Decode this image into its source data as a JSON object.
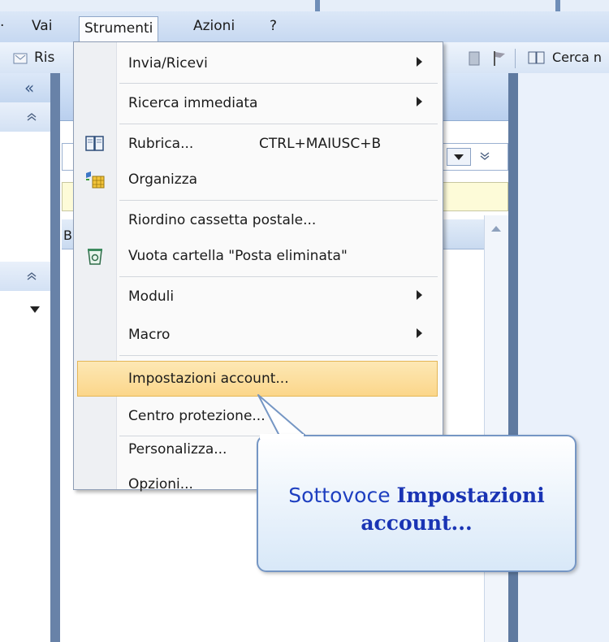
{
  "menubar": {
    "items": [
      {
        "label": "Vai"
      },
      {
        "label": "Strumenti"
      },
      {
        "label": "Azioni"
      },
      {
        "label": "?"
      }
    ]
  },
  "toolbar": {
    "partial_button_label": "Ris",
    "search_label": "Cerca n"
  },
  "navpane": {
    "collapse_symbol": "«",
    "section_toggle_symbol": "⌃"
  },
  "list_pane": {
    "header_letter": "B"
  },
  "dropdown": {
    "items": [
      {
        "label": "Invia/Ricevi",
        "submenu": true
      },
      {
        "label": "Ricerca immediata",
        "submenu": true
      },
      {
        "label": "Rubrica...",
        "shortcut": "CTRL+MAIUSC+B",
        "icon": "address-book-icon"
      },
      {
        "label": "Organizza",
        "icon": "organize-icon"
      },
      {
        "label": "Riordino cassetta postale..."
      },
      {
        "label": "Vuota cartella \"Posta eliminata\"",
        "icon": "empty-trash-icon"
      },
      {
        "label": "Moduli",
        "submenu": true
      },
      {
        "label": "Macro",
        "submenu": true
      },
      {
        "label": "Impostazioni account...",
        "highlighted": true
      },
      {
        "label": "Centro protezione..."
      },
      {
        "label": "Personalizza..."
      },
      {
        "label": "Opzioni..."
      }
    ]
  },
  "callout": {
    "prefix": "Sottovoce ",
    "bold_line1": "Impostazioni",
    "bold_line2": "account..."
  },
  "colors": {
    "highlight": "#fbd68a",
    "callout_text": "#1e3fc0",
    "chrome_blue": "#c6d8f1"
  }
}
